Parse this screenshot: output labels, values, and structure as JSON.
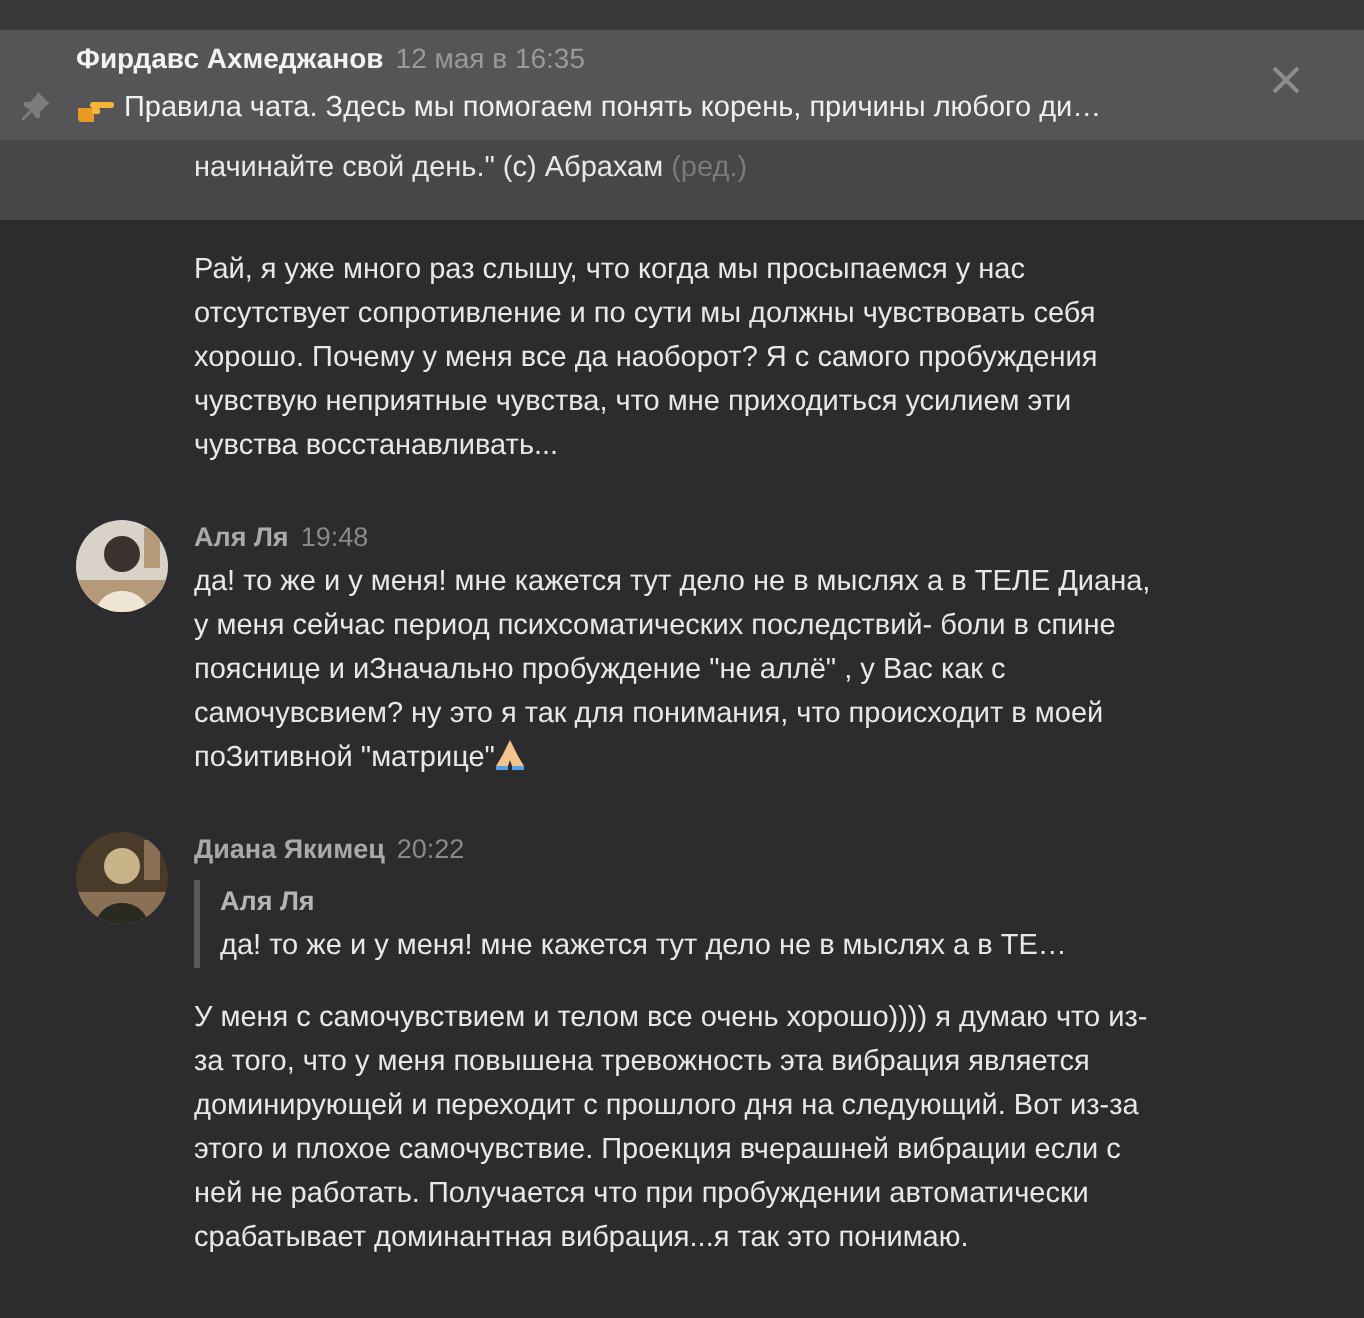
{
  "pinned": {
    "author": "Фирдавс Ахмеджанов",
    "time": "12 мая в 16:35",
    "text": "Правила чата. Здесь мы помогаем понять корень, причины любого ди…"
  },
  "messages": [
    {
      "kind": "tail",
      "text": "начинайте свой день.\" (c) Абрахам",
      "edited": "(ред.)"
    },
    {
      "kind": "continuation",
      "text": "Рай, я уже много раз слышу, что когда мы просыпаемся у нас отсутствует сопротивление и по сути мы должны чувствовать себя хорошо. Почему у меня все да наоборот? Я с самого пробуждения чувствую неприятные чувства, что мне приходиться усилием эти чувства восстанавливать..."
    },
    {
      "kind": "message",
      "author": "Аля Ля",
      "time": "19:48",
      "text": "да! то же и у меня! мне кажется тут дело не в мыслях а в ТЕЛЕ Диана, у меня сейчас период психсоматических последствий- боли в спине пояснице и иЗначально пробуждение \"не аллё\" , у Вас как с самочувсвием? ну это я так для понимания, что происходит в моей поЗитивной \"матрице\"",
      "end_icon": true
    },
    {
      "kind": "message",
      "author": "Диана Якимец",
      "time": "20:22",
      "reply": {
        "author": "Аля Ля",
        "text": "да! то же и у меня! мне кажется тут дело не в мыслях а в ТЕ…"
      },
      "text": "У меня с самочувствием и телом все очень хорошо)))) я думаю что из-за того, что у меня повышена тревожность эта вибрация является доминирующей и переходит с прошлого дня на следующий. Вот из-за этого и плохое самочувствие. Проекция вчерашней вибрации если с ней не работать. Получается что при пробуждении автоматически срабатывает доминантная вибрация...я так это понимаю."
    }
  ]
}
